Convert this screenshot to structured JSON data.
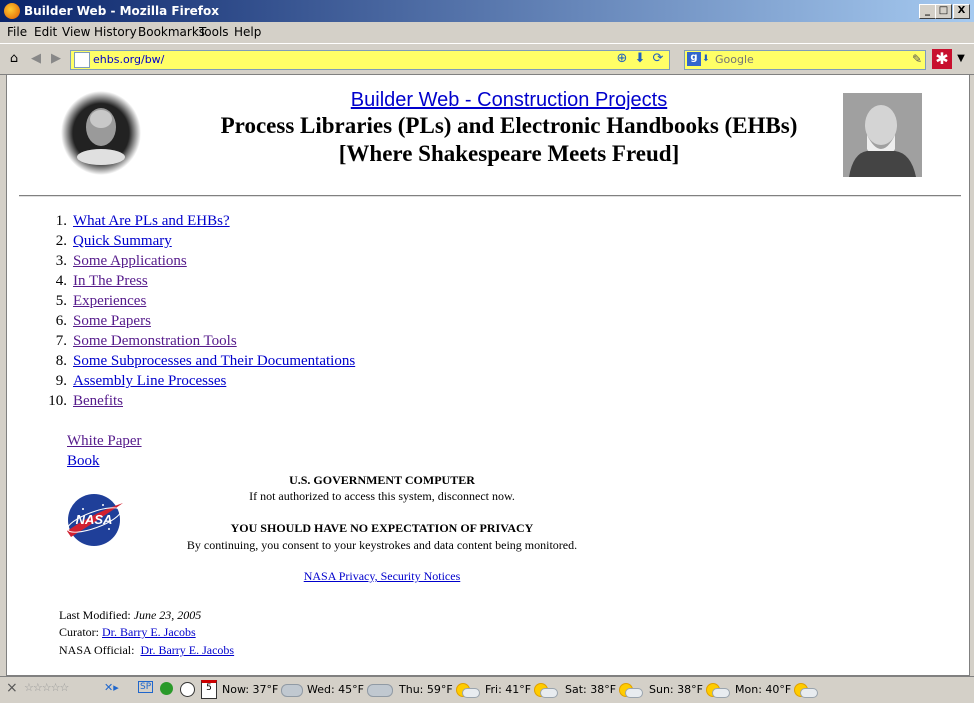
{
  "window": {
    "title": "Builder Web - Mozilla Firefox",
    "min": "_",
    "max": "□",
    "close": "X"
  },
  "menu": [
    "File",
    "Edit",
    "View",
    "History",
    "Bookmarks",
    "Tools",
    "Help"
  ],
  "nav": {
    "url": "ehbs.org/bw/",
    "search_placeholder": "Google"
  },
  "page": {
    "header_link": "Builder Web - Construction Projects",
    "title_line1": "Process Libraries (PLs) and Electronic Handbooks (EHBs)",
    "title_line2": "[Where Shakespeare Meets Freud]",
    "items": [
      {
        "num": "1.",
        "label": "What Are PLs and EHBs?",
        "visited": false
      },
      {
        "num": "2.",
        "label": "Quick Summary",
        "visited": false
      },
      {
        "num": "3.",
        "label": "Some Applications",
        "visited": true
      },
      {
        "num": "4.",
        "label": "In The Press",
        "visited": true
      },
      {
        "num": "5.",
        "label": "Experiences",
        "visited": true
      },
      {
        "num": "6.",
        "label": "Some Papers",
        "visited": true
      },
      {
        "num": "7.",
        "label": "Some Demonstration Tools",
        "visited": true
      },
      {
        "num": "8.",
        "label": "Some Subprocesses and Their Documentations",
        "visited": false
      },
      {
        "num": "9.",
        "label": "Assembly Line Processes",
        "visited": false
      },
      {
        "num": "10.",
        "label": "Benefits",
        "visited": true
      }
    ],
    "white_paper": "White Paper",
    "book": "Book",
    "nasa_logo_text": "NASA",
    "gov_title": "U.S. GOVERNMENT COMPUTER",
    "gov_line1": "If not authorized to access this system, disconnect now.",
    "privacy_title": "YOU SHOULD HAVE NO EXPECTATION OF PRIVACY",
    "privacy_line": "By continuing, you consent to your keystrokes and data content being monitored.",
    "privacy_link": "NASA Privacy, Security Notices",
    "last_modified_label": "Last Modified:",
    "last_modified": "June 23, 2005",
    "curator_label": "Curator:",
    "curator": "Dr. Barry E. Jacobs",
    "official_label": "NASA Official:",
    "official": "Dr. Barry E. Jacobs"
  },
  "status": {
    "close": "×",
    "sp": "SP",
    "calendar": "5",
    "weather": [
      {
        "label": "Now: 37°F",
        "icon": "cloud"
      },
      {
        "label": "Wed: 45°F",
        "icon": "cloud"
      },
      {
        "label": "Thu: 59°F",
        "icon": "sun"
      },
      {
        "label": "Fri: 41°F",
        "icon": "sun"
      },
      {
        "label": "Sat: 38°F",
        "icon": "sun"
      },
      {
        "label": "Sun: 38°F",
        "icon": "sun"
      },
      {
        "label": "Mon: 40°F",
        "icon": "sun"
      }
    ]
  }
}
